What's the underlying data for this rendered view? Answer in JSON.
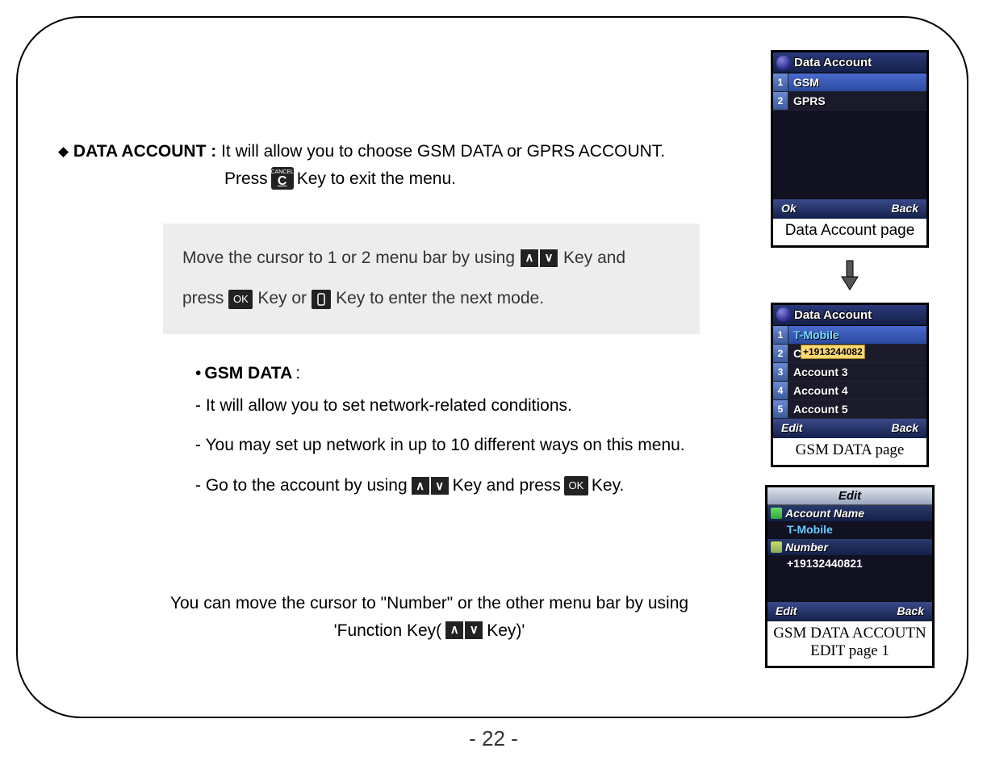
{
  "page_number": "- 22 -",
  "heading": {
    "diamond": "◆",
    "title": "DATA ACCOUNT :",
    "description": " It will allow you to choose GSM DATA or  GPRS ACCOUNT."
  },
  "press_line": {
    "before": "Press",
    "key_cancel_top": "CANCEL",
    "key_cancel_letter": "C",
    "after": " Key to exit the menu."
  },
  "grey_box": {
    "line1_a": "Move the cursor to 1 or 2 menu bar by using",
    "line1_b": " Key and",
    "line2_a": "press ",
    "ok_label": "OK",
    "line2_b": " Key or",
    "line2_c": " Key to enter the next mode."
  },
  "gsm_block": {
    "title_bullet": "•",
    "title": "GSM DATA",
    "title_after": " :",
    "l1": "- It will allow you to set network-related conditions.",
    "l2": "- You may set up network in up to 10 different ways on this menu.",
    "l3a": "- Go to the account by using ",
    "l3b": " Key and press",
    "l3_ok": "OK",
    "l3c": " Key."
  },
  "footer": {
    "l1": "You can move the cursor to \"Number\" or the other menu bar by using",
    "l2a": "'Function Key( ",
    "l2b": " Key)'"
  },
  "phone1": {
    "title": "Data Account",
    "rows": [
      {
        "n": "1",
        "label": "GSM"
      },
      {
        "n": "2",
        "label": "GPRS"
      }
    ],
    "soft_left": "Ok",
    "soft_right": "Back",
    "caption": "Data Account page"
  },
  "phone2": {
    "title": "Data Account",
    "tooltip": "+1913244082",
    "rows": [
      {
        "n": "1",
        "label": "T-Mobile"
      },
      {
        "n": "2",
        "label": "C"
      },
      {
        "n": "3",
        "label": "Account 3"
      },
      {
        "n": "4",
        "label": "Account 4"
      },
      {
        "n": "5",
        "label": "Account 5"
      }
    ],
    "soft_left": "Edit",
    "soft_right": "Back",
    "caption": "GSM DATA page"
  },
  "phone3": {
    "edit_title": "Edit",
    "field1_label": "Account Name",
    "field1_value": "T-Mobile",
    "field2_label": "Number",
    "field2_value": "+19132440821",
    "soft_left": "Edit",
    "soft_right": "Back",
    "caption_l1": "GSM DATA ACCOUTN",
    "caption_l2": "EDIT page 1"
  }
}
